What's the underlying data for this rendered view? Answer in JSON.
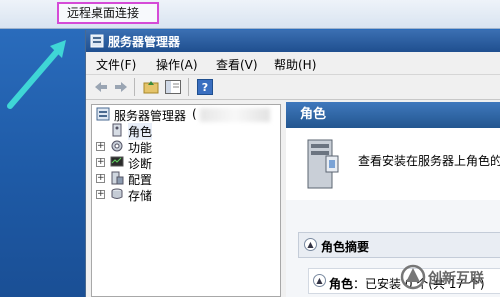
{
  "rdc": {
    "title": "远程桌面连接"
  },
  "window": {
    "title": "服务器管理器"
  },
  "menu": [
    "文件(F)",
    "操作(A)",
    "查看(V)",
    "帮助(H)"
  ],
  "toolbar": {
    "icons": [
      "back-icon",
      "forward-icon",
      "up-folder-icon",
      "show-hide-tree-icon",
      "help-icon"
    ]
  },
  "tree": {
    "root": "服务器管理器",
    "root_suffix": "(",
    "items": [
      {
        "label": "角色",
        "selected": true
      },
      {
        "label": "功能"
      },
      {
        "label": "诊断"
      },
      {
        "label": "配置"
      },
      {
        "label": "存储"
      }
    ]
  },
  "content": {
    "header": "角色",
    "info": "查看安装在服务器上角色的",
    "summary_title": "角色摘要",
    "roles_label": "角色",
    "roles_text": "：已安装 0 个(共 17 个)"
  },
  "watermark": {
    "text": "创新互联"
  },
  "colors": {
    "accent": "#d54bd7",
    "arrow": "#3fd6d6",
    "titlebar": "#2a5da0"
  }
}
